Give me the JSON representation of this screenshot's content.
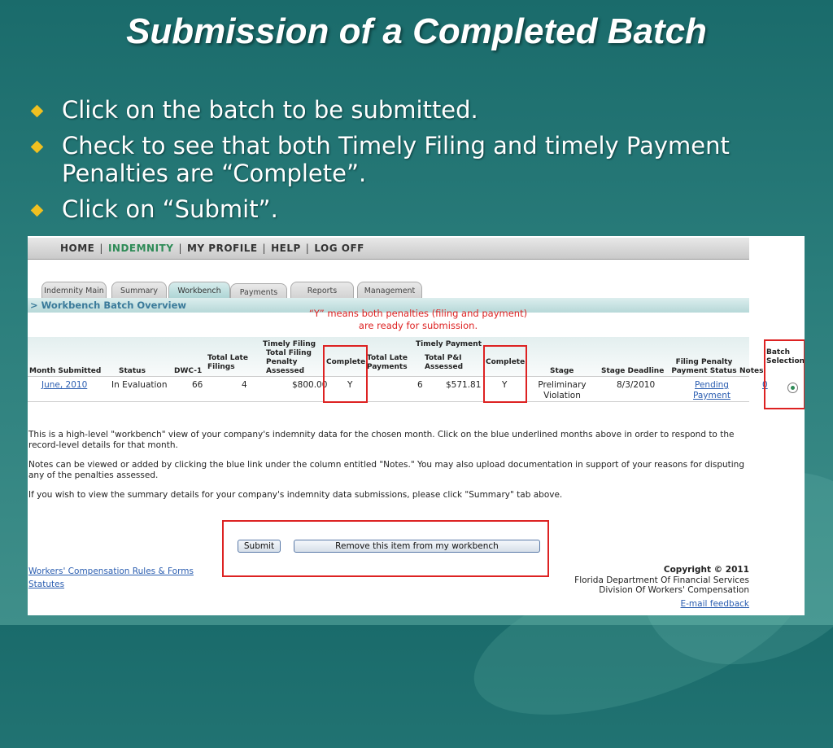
{
  "slide": {
    "title": "Submission of a Completed Batch",
    "bullets": [
      "Click on the batch to be submitted.",
      "Check to see that both Timely Filing and timely Payment Penalties are “Complete”.",
      "Click on “Submit”."
    ]
  },
  "nav": {
    "items": [
      "HOME",
      "INDEMNITY",
      "MY PROFILE",
      "HELP",
      "LOG OFF"
    ],
    "sep": "|"
  },
  "tabs": [
    "Indemnity Main",
    "Summary",
    "Workbench",
    "Payments",
    "Reports",
    "Management"
  ],
  "breadcrumb": "> Workbench Batch Overview",
  "annotation": "“Y” means both penalties (filing and payment) are ready for submission.",
  "table": {
    "group_timely_filing": "Timely Filing",
    "group_timely_payment": "Timely Payment",
    "headers": {
      "month": "Month Submitted",
      "status": "Status",
      "dwc": "DWC-1",
      "total_late_filings": "Total Late Filings",
      "total_filing_penalty": "Total Filing Penalty Assessed",
      "complete_filing": "Complete",
      "total_late_payments": "Total Late Payments",
      "total_pi": "Total P&I Assessed",
      "complete_payment": "Complete",
      "stage": "Stage",
      "stage_deadline": "Stage Deadline",
      "filing_penalty_status": "Filing Penalty Payment Status",
      "notes": "Notes",
      "batch_selection": "Batch Selection"
    },
    "row": {
      "month": "June, 2010",
      "status": "In Evaluation",
      "dwc": "66",
      "total_late_filings": "4",
      "total_filing_penalty": "$800.00",
      "complete_filing": "Y",
      "total_late_payments": "6",
      "total_pi": "$571.81",
      "complete_payment": "Y",
      "stage_line1": "Preliminary",
      "stage_line2": "Violation",
      "stage_deadline": "8/3/2010",
      "payment_status_line1": "Pending",
      "payment_status_line2": "Payment",
      "notes": "0"
    }
  },
  "paragraphs": [
    "This is a high-level \"workbench\" view of your company's indemnity  data for the chosen month. Click on the blue underlined months above in order to respond to the record-level details for that month.",
    "Notes can be viewed or added by clicking the blue link under the column entitled \"Notes.\" You may also upload documentation in support of your reasons for disputing any of the penalties assessed.",
    "If you wish to view the summary details for your company's indemnity  data submissions, please click \"Summary\" tab above."
  ],
  "buttons": {
    "submit": "Submit",
    "remove": "Remove this item from my workbench"
  },
  "footer": {
    "link1": "Workers' Compensation Rules & Forms",
    "link2": "Statutes",
    "copyright": "Copyright © 2011",
    "org1": "Florida Department Of Financial Services",
    "org2": "Division Of Workers' Compensation",
    "feedback": "E-mail feedback"
  },
  "colors": {
    "accent_red": "#dd2222",
    "link_blue": "#2a5db0",
    "nav_active_green": "#2e8b57",
    "bullet_gold": "#f0c020"
  }
}
